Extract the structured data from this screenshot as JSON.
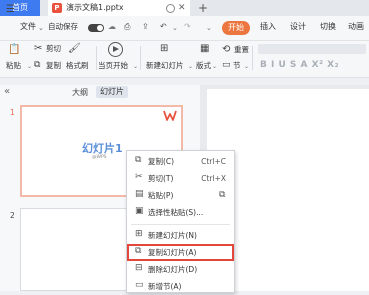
{
  "tabs": {
    "home": "首页",
    "document": "演示文稿1.pptx",
    "ppt_badge": "P"
  },
  "menu": {
    "file": "文件",
    "autosave": "自动保存",
    "start": "开始",
    "insert": "插入",
    "design": "设计",
    "switch": "切换",
    "animation": "动画"
  },
  "toolbar": {
    "cut": "剪切",
    "copy": "复制",
    "format_painter": "格式刷",
    "paste": "粘贴",
    "from_current": "当页开始",
    "new_slide": "新建幻灯片",
    "layout": "版式",
    "section": "节",
    "reset": "重置",
    "font_format": "B  I  U  S  A  X²  X₂"
  },
  "panel": {
    "outline": "大纲",
    "slides": "幻灯片",
    "slide1_number": "1",
    "slide2_number": "2",
    "slide1_title": "幻灯片1",
    "slide1_sub": "@WPS"
  },
  "context_menu": {
    "items": [
      {
        "label": "复制(C)",
        "shortcut": "Ctrl+C"
      },
      {
        "label": "剪切(T)",
        "shortcut": "Ctrl+X"
      },
      {
        "label": "粘贴(P)",
        "shortcut": ""
      },
      {
        "label": "选择性粘贴(S)...",
        "shortcut": ""
      },
      {
        "label": "新建幻灯片(N)",
        "shortcut": ""
      },
      {
        "label": "复制幻灯片(A)",
        "shortcut": ""
      },
      {
        "label": "删除幻灯片(D)",
        "shortcut": ""
      },
      {
        "label": "新增节(A)",
        "shortcut": ""
      }
    ]
  },
  "colors": {
    "accent": "#3e7bf0",
    "start_tab": "#ec7640",
    "highlight": "#e3463a"
  }
}
